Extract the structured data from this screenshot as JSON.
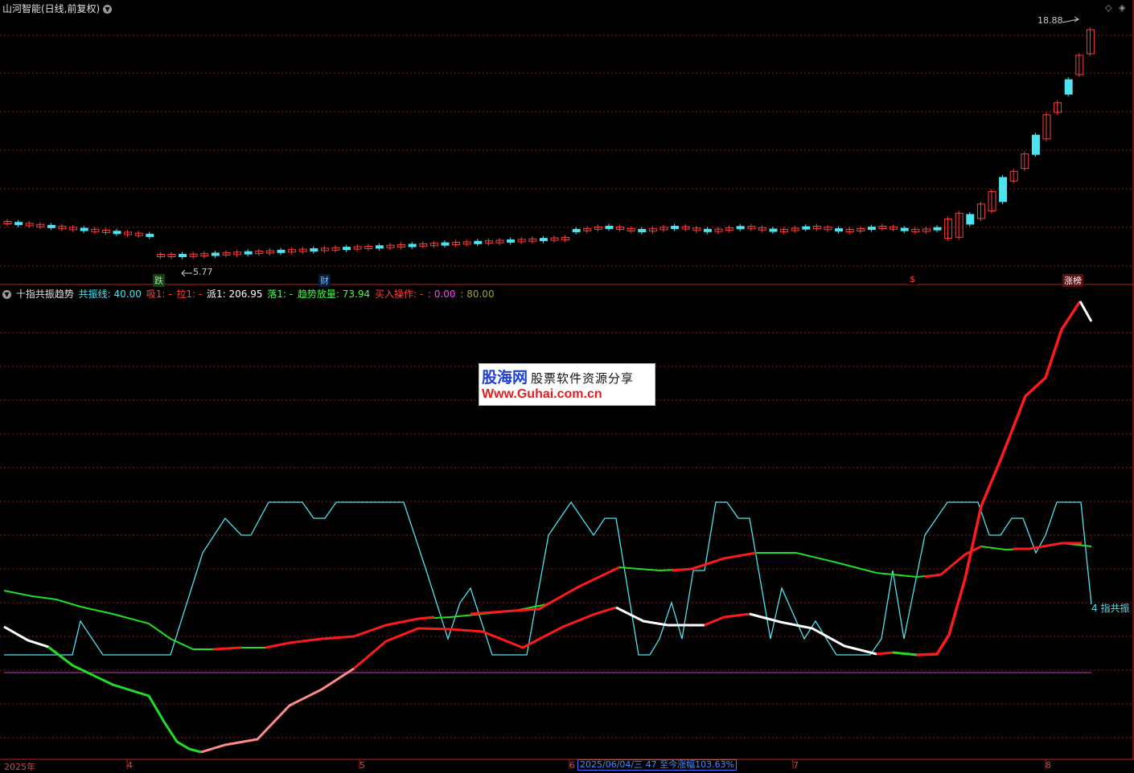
{
  "header": {
    "title": "山河智能(日线,前复权)",
    "price_high_label": "18.88",
    "price_low_label": "5.77",
    "corner_icons": [
      "diamond-icon",
      "settings-icon"
    ]
  },
  "markers": [
    {
      "text": "跌",
      "color": "#7CFC7C",
      "bg": "#1a3a1a"
    },
    {
      "text": "财",
      "color": "#7fbfff",
      "bg": "#0a1a33"
    },
    {
      "text": "$",
      "color": "#ff4040",
      "bg": "#000000"
    },
    {
      "text": "涨榜",
      "color": "#ffffff",
      "bg": "#5a1010"
    }
  ],
  "indicator": {
    "name": "十指共振趋势",
    "items": [
      {
        "label": "共振线:",
        "value": "40.00",
        "color": "#4fe3f0"
      },
      {
        "label": "吸1:",
        "value": "-",
        "color": "#ff4040"
      },
      {
        "label": "拉1:",
        "value": "-",
        "color": "#ff4040"
      },
      {
        "label": "派1:",
        "value": "206.95",
        "color": "#ffffff"
      },
      {
        "label": "落1:",
        "value": "-",
        "color": "#40ff40"
      },
      {
        "label": "趋势放量:",
        "value": "73.94",
        "color": "#40ff40"
      },
      {
        "label": "买入操作:",
        "value": "-",
        "color": "#ff4040"
      },
      {
        "label": ":",
        "value": "0.00",
        "color": "#ff40ff"
      },
      {
        "label": ":",
        "value": "80.00",
        "color": "#a0a020"
      }
    ],
    "side_label": "4 指共振"
  },
  "watermark": {
    "brand": "股海网",
    "tagline": "股票软件资源分享",
    "url": "Www.Guhai.com.cn"
  },
  "axis": {
    "labels": [
      "2025年",
      "4",
      "5",
      "6",
      "7",
      "8"
    ],
    "status_text": "2025/06/04/三 47 至今涨幅103.63%"
  },
  "colors": {
    "up": "#ff3b3b",
    "down": "#4fe3f0",
    "grid": "#8b1a1a",
    "resonance": "#4fe3f0",
    "trend_red": "#ff1a1a",
    "trend_green": "#22dd22",
    "magenta": "#c040c0"
  }
}
